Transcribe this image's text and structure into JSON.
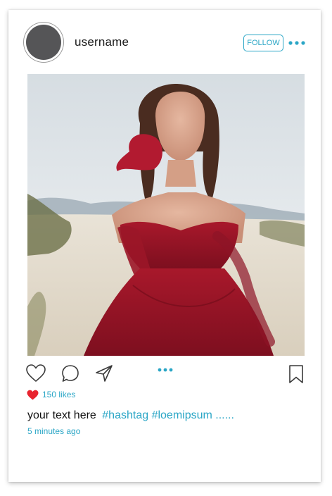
{
  "header": {
    "username": "username",
    "follow_label": "FOLLOW",
    "more_icon": "more-horizontal-icon"
  },
  "post": {
    "image_description_icon": "photo",
    "carousel_indicator_icon": "carousel-dots-icon"
  },
  "actions": {
    "like_icon": "heart-outline-icon",
    "comment_icon": "comment-icon",
    "share_icon": "send-icon",
    "save_icon": "bookmark-icon"
  },
  "likes": {
    "heart_icon": "heart-filled-icon",
    "count_text": "150 likes"
  },
  "caption": {
    "text": "your text here",
    "hashtags": "#hashtag #loemipsum ......",
    "timestamp": "5 minutes ago"
  },
  "colors": {
    "accent": "#2aa6c6",
    "heart": "#e8242f",
    "avatar": "#555557",
    "icon_stroke": "#3a3a3a"
  }
}
